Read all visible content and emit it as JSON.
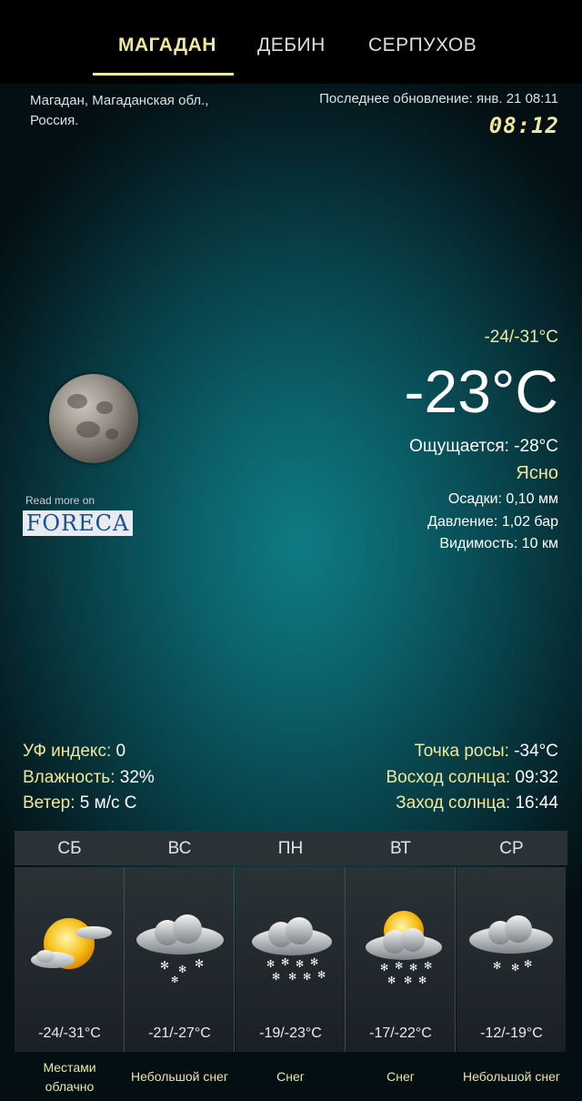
{
  "tabs": [
    "МАГАДАН",
    "ДЕБИН",
    "СЕРПУХОВ"
  ],
  "location": {
    "line1": "Магадан, Магаданская обл.,",
    "line2": "Россия."
  },
  "update_label": "Последнее обновление: янв. 21  08:11",
  "clock": "08:12",
  "read_more": "Read more on",
  "brand": "FORECA",
  "current": {
    "range": "-24/-31°C",
    "temp": "-23°C",
    "feels": "Ощущается: -28°C",
    "condition": "Ясно",
    "precip": "Осадки: 0,10 мм",
    "pressure": "Давление: 1,02 бар",
    "visibility": "Видимость: 10 км"
  },
  "stats_left": [
    {
      "label": "УФ индекс:",
      "value": " 0"
    },
    {
      "label": "Влажность:",
      "value": " 32%"
    },
    {
      "label": "Ветер:",
      "value": " 5 м/с С"
    }
  ],
  "stats_right": [
    {
      "label": "Точка росы:",
      "value": " -34°C"
    },
    {
      "label": "Восход солнца:",
      "value": " 09:32"
    },
    {
      "label": "Заход солнца:",
      "value": " 16:44"
    }
  ],
  "forecast": [
    {
      "day": "СБ",
      "temp": "-24/-31°C",
      "cond1": "Местами",
      "cond2": "облачно",
      "icon": "partly-cloudy-icon"
    },
    {
      "day": "ВС",
      "temp": "-21/-27°C",
      "cond1": "Небольшой снег",
      "cond2": "",
      "icon": "light-snow-icon"
    },
    {
      "day": "ПН",
      "temp": "-19/-23°C",
      "cond1": "Снег",
      "cond2": "",
      "icon": "snow-icon"
    },
    {
      "day": "ВТ",
      "temp": "-17/-22°C",
      "cond1": "Снег",
      "cond2": "",
      "icon": "sun-snow-icon"
    },
    {
      "day": "СР",
      "temp": "-12/-19°C",
      "cond1": "Небольшой снег",
      "cond2": "",
      "icon": "light-snow-icon"
    }
  ],
  "colors": {
    "accent": "#efe89a",
    "background": "#0b5f68"
  }
}
